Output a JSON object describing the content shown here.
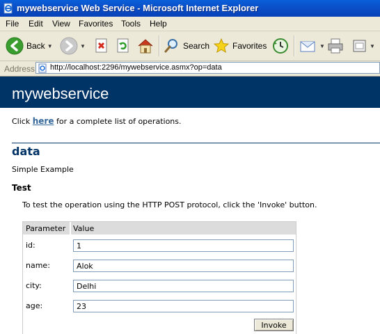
{
  "window": {
    "title": "mywebservice Web Service - Microsoft Internet Explorer"
  },
  "menu": [
    "File",
    "Edit",
    "View",
    "Favorites",
    "Tools",
    "Help"
  ],
  "toolbar": {
    "back_label": "Back",
    "search_label": "Search",
    "favorites_label": "Favorites"
  },
  "address": {
    "label": "Address",
    "url": "http://localhost:2296/mywebservice.asmx?op=data"
  },
  "page": {
    "service_name": "mywebservice",
    "intro_prefix": "Click ",
    "intro_link": "here",
    "intro_suffix": " for a complete list of operations.",
    "operation_name": "data",
    "operation_description": "Simple Example",
    "test_heading": "Test",
    "test_description": "To test the operation using the HTTP POST protocol, click the 'Invoke' button.",
    "table_headers": [
      "Parameter",
      "Value"
    ],
    "params": [
      {
        "label": "id:",
        "value": "1"
      },
      {
        "label": "name:",
        "value": "Alok"
      },
      {
        "label": "city:",
        "value": "Delhi"
      },
      {
        "label": "age:",
        "value": "23"
      }
    ],
    "invoke_label": "Invoke"
  },
  "colors": {
    "banner": "#003366",
    "link": "#336699",
    "titlebar": "#0a4fc8",
    "chrome": "#ece9d8"
  }
}
